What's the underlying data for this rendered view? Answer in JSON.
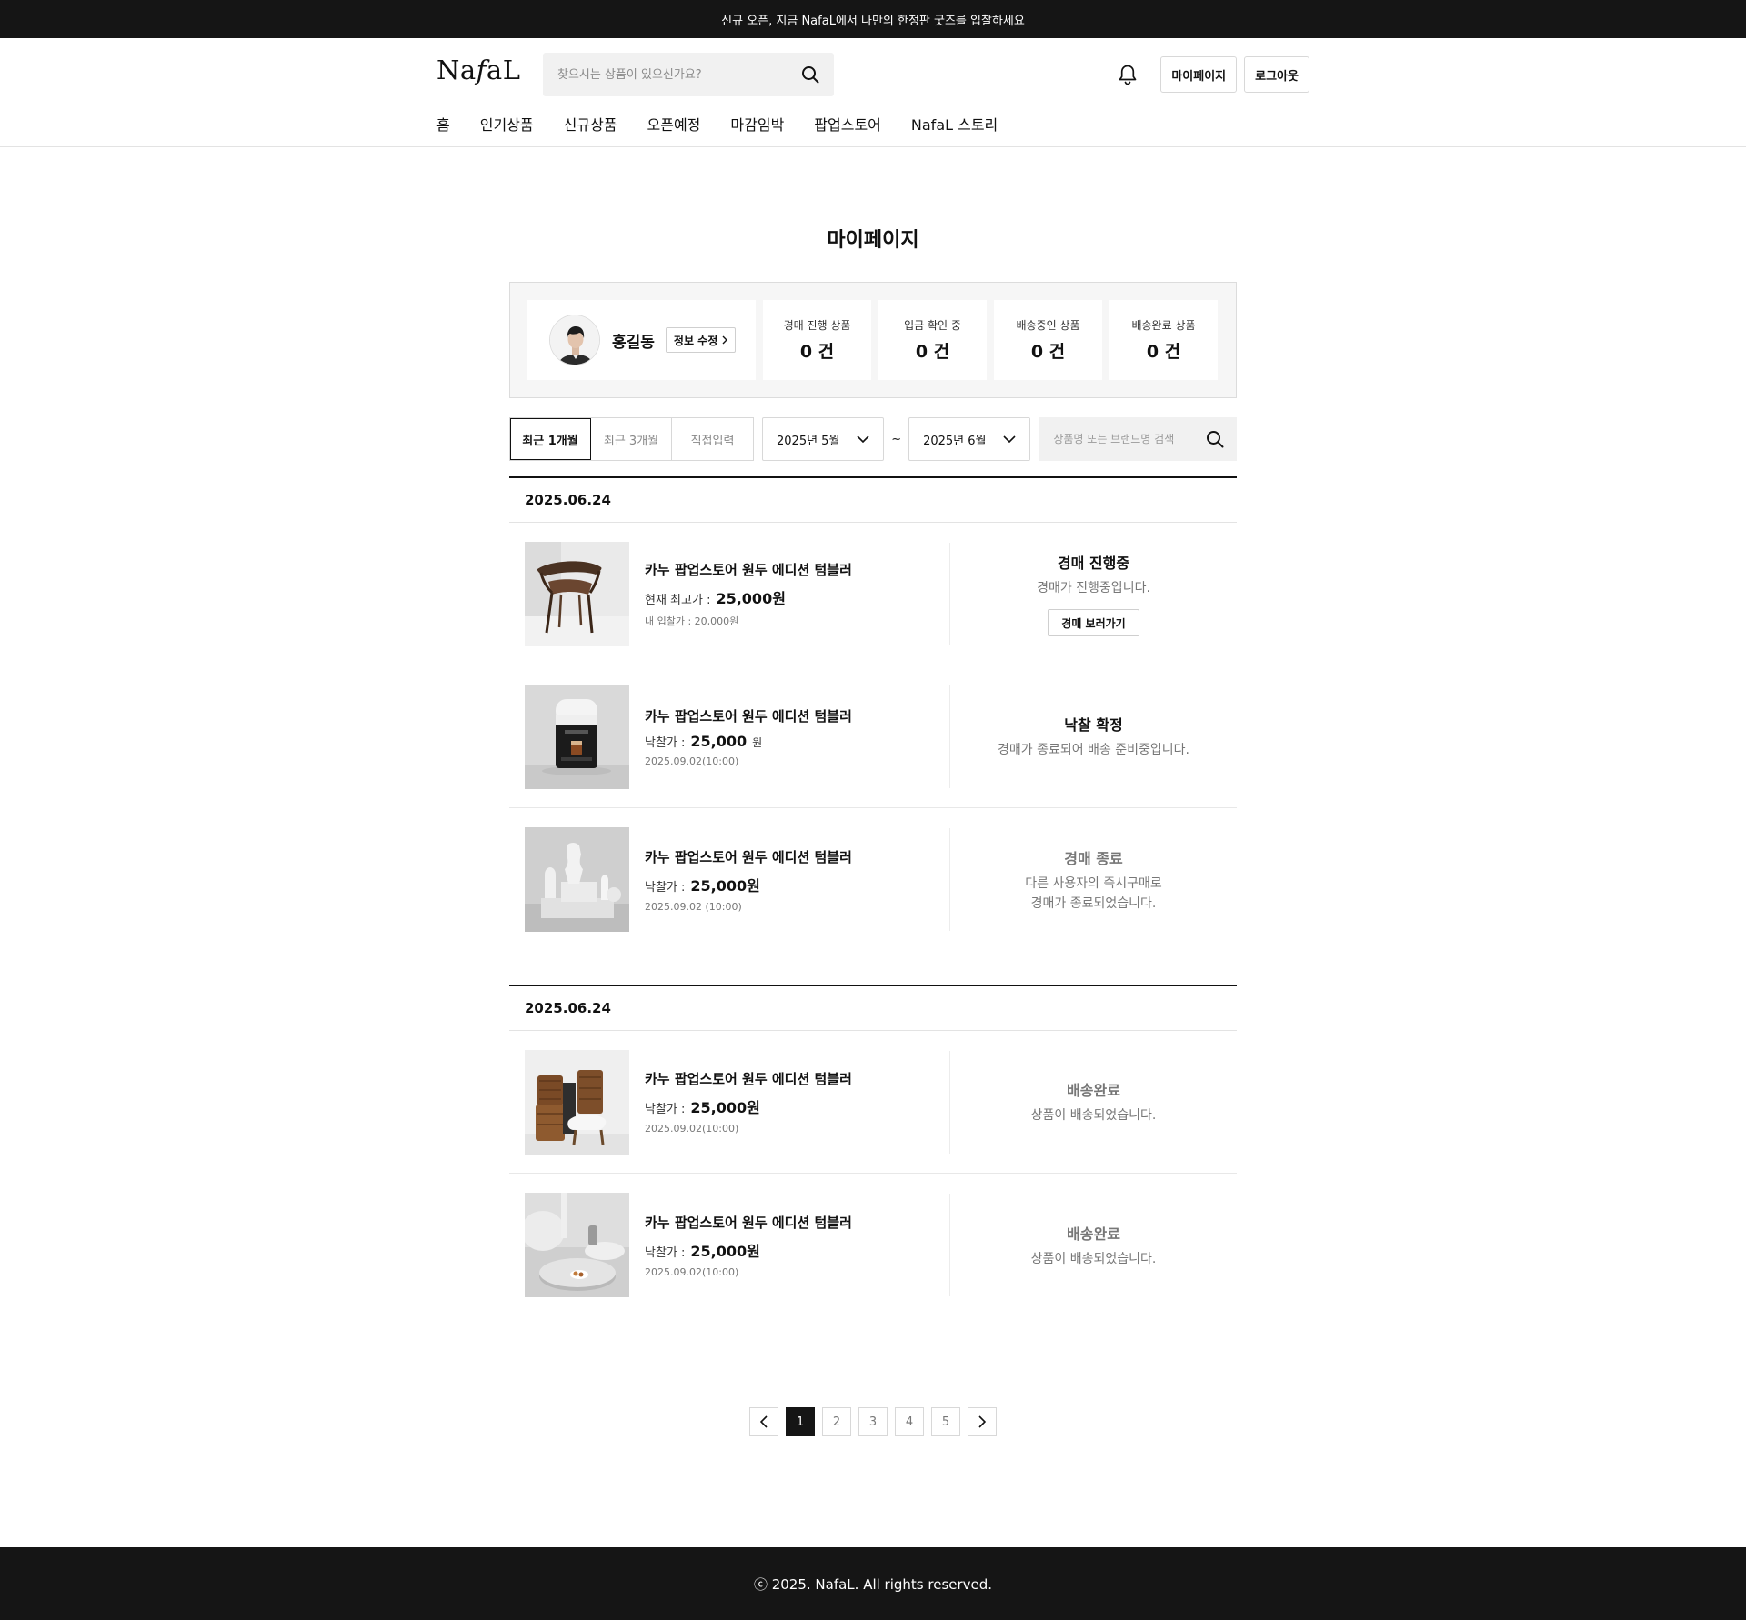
{
  "topbar": {
    "text": "신규 오픈, 지금 NafaL에서 나만의 한정판 굿즈를 입찰하세요"
  },
  "header": {
    "logo_pre": "Na",
    "logo_f": "f",
    "logo_post": "aL",
    "search_placeholder": "찾으시는 상품이 있으신가요?",
    "mypage_label": "마이페이지",
    "logout_label": "로그아웃",
    "nav": [
      "홈",
      "인기상품",
      "신규상품",
      "오픈예정",
      "마감임박",
      "팝업스토어",
      "NafaL 스토리"
    ]
  },
  "page": {
    "title": "마이페이지"
  },
  "profile": {
    "name": "홍길동",
    "edit_label": "정보 수정"
  },
  "stats": [
    {
      "label": "경매 진행 상품",
      "value": "0 건"
    },
    {
      "label": "입금 확인 중",
      "value": "0 건"
    },
    {
      "label": "배송중인 상품",
      "value": "0 건"
    },
    {
      "label": "배송완료 상품",
      "value": "0 건"
    }
  ],
  "filters": {
    "periods": [
      "최근 1개월",
      "최근 3개월",
      "직접입력"
    ],
    "active_period": "최근 1개월",
    "from": "2025년 5월",
    "tilde": "~",
    "to": "2025년 6월",
    "search_placeholder": "상품명 또는 브랜드명 검색"
  },
  "groups": [
    {
      "date": "2025.06.24",
      "orders": [
        {
          "name": "카누 팝업스토어 원두 에디션 텀블러",
          "price_label": "현재 최고가 :",
          "price": "25,000원",
          "sub": "내 입찰가 :  20,000원",
          "status": "경매 진행중",
          "desc": "경매가 진행중입니다.",
          "button": "경매 보러가기",
          "image": "chair"
        },
        {
          "name": "카누 팝업스토어 원두 에디션 텀블러",
          "price_label": "낙찰가 :",
          "price": "25,000",
          "unit": "원",
          "sub": "2025.09.02(10:00)",
          "status": "낙찰 확정",
          "desc": "경매가 종료되어 배송 준비중입니다.",
          "image": "coffee-machine"
        },
        {
          "name": "카누 팝업스토어 원두 에디션 텀블러",
          "price_label": "낙찰가 :",
          "price": "25,000원",
          "sub": "2025.09.02 (10:00)",
          "status": "경매 종료",
          "desc": "다른 사용자의 즉시구매로",
          "desc2": "경매가 종료되었습니다.",
          "image": "vases"
        }
      ]
    },
    {
      "date": "2025.06.24",
      "orders": [
        {
          "name": "카누 팝업스토어 원두 에디션 텀블러",
          "price_label": "낙찰가 :",
          "price": "25,000원",
          "sub": "2025.09.02(10:00)",
          "status": "배송완료",
          "desc": "상품이 배송되었습니다.",
          "image": "baskets"
        },
        {
          "name": "카누 팝업스토어 원두 에디션 텀블러",
          "price_label": "낙찰가 :",
          "price": "25,000원",
          "sub": "2025.09.02(10:00)",
          "status": "배송완료",
          "desc": "상품이 배송되었습니다.",
          "image": "living-room"
        }
      ]
    }
  ],
  "pagination": {
    "pages": [
      "1",
      "2",
      "3",
      "4",
      "5"
    ],
    "current": "1"
  },
  "footer": {
    "text": "ⓒ 2025. NafaL. All rights reserved."
  }
}
